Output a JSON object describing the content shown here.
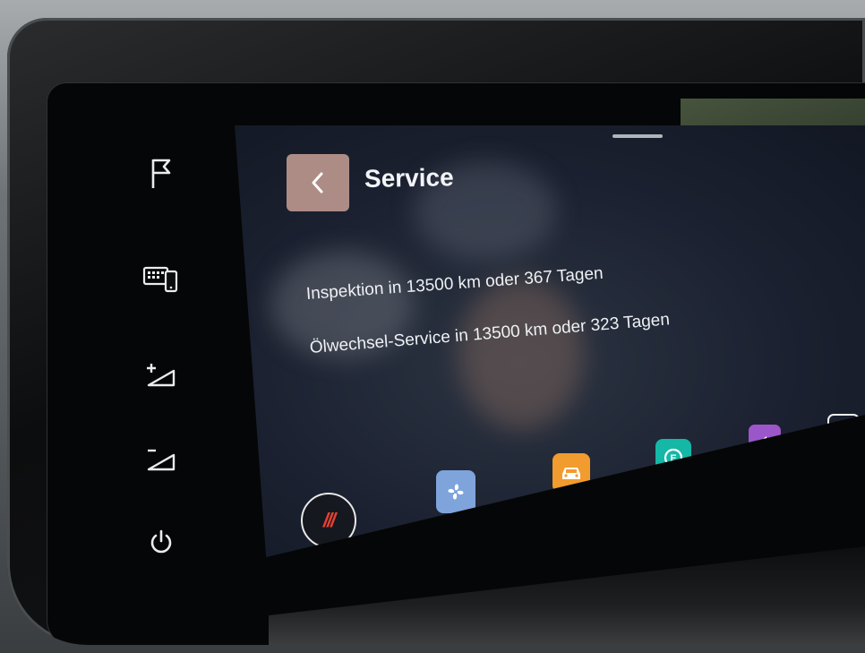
{
  "screen": {
    "title": "Service",
    "messages": [
      "Inspektion in 13500 km oder 367 Tagen",
      "Ölwechsel-Service in 13500 km oder 323 Tagen"
    ]
  },
  "hardware_keys": [
    {
      "name": "flag-icon"
    },
    {
      "name": "keyboard-phone-icon"
    },
    {
      "name": "volume-up-icon"
    },
    {
      "name": "volume-down-icon"
    },
    {
      "name": "power-icon"
    }
  ],
  "dock": {
    "home_label": "///",
    "items": [
      {
        "name": "climate",
        "icon": "fan-icon",
        "color": "#7fa4dc"
      },
      {
        "name": "vehicle",
        "icon": "car-icon",
        "color": "#f29b2e"
      },
      {
        "name": "ev",
        "icon": "e-charge-icon",
        "color": "#15b7a6"
      },
      {
        "name": "sound",
        "icon": "speaker-icon",
        "color": "#9b57c9"
      },
      {
        "name": "add",
        "icon": "plus-icon"
      }
    ]
  },
  "colors": {
    "back_button": "#c8a096",
    "home_accent": "#e8402f"
  }
}
